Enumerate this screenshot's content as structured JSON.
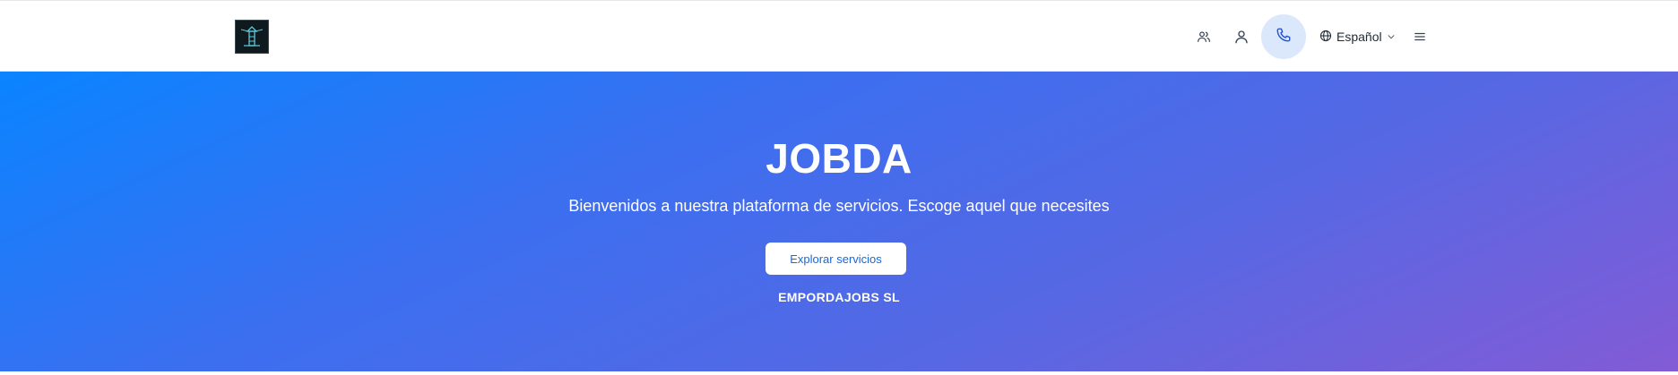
{
  "header": {
    "logo_icon": "lighthouse-logo-icon",
    "nav_icons": [
      "users-icon",
      "user-icon",
      "phone-icon",
      "globe-icon",
      "menu-icon"
    ],
    "language": {
      "selected": "Español",
      "icon": "chevron-down-icon"
    },
    "phone_button_bg": "#dbe8fb",
    "accent": "#1d4ed8"
  },
  "hero": {
    "title": "JOBDA",
    "subtitle": "Bienvenidos a nuestra plataforma de servicios. Escoge aquel que necesites",
    "cta_label": "Explorar servicios",
    "company": "EMPORDAJOBS SL",
    "gradient_start": "#0a84ff",
    "gradient_end": "#835bd6"
  }
}
